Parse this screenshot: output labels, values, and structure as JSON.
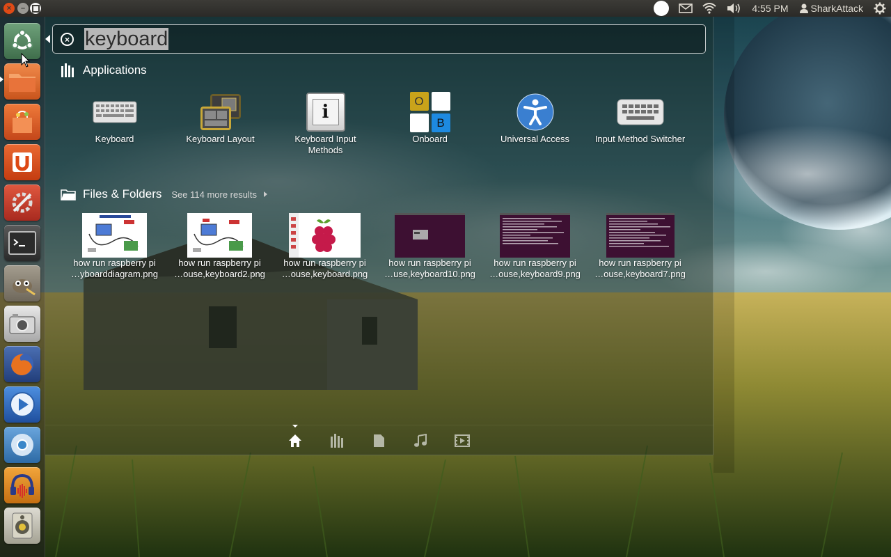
{
  "panel": {
    "clock": "4:55 PM",
    "user": "SharkAttack",
    "window_buttons": {
      "close": "×",
      "minimize": "–"
    },
    "indicators": [
      "notification-dot",
      "mail-icon",
      "wifi-icon",
      "volume-icon",
      "user-icon",
      "gear-icon"
    ]
  },
  "launcher": {
    "items": [
      {
        "name": "dash-home",
        "icon": "ubuntu-logo-icon",
        "color": "#5c8e6a"
      },
      {
        "name": "files",
        "icon": "folder-icon",
        "color": "#e0672a"
      },
      {
        "name": "software-center",
        "icon": "shopping-bag-icon",
        "color": "#d9572a"
      },
      {
        "name": "ubuntu-one",
        "icon": "ubuntu-one-icon",
        "color": "#dd4814"
      },
      {
        "name": "system-settings",
        "icon": "settings-wrench-icon",
        "color": "#c83a2e"
      },
      {
        "name": "terminal",
        "icon": "terminal-icon",
        "color": "#3a3a3a"
      },
      {
        "name": "gimp",
        "icon": "gimp-icon",
        "color": "#8a8376"
      },
      {
        "name": "screenshot",
        "icon": "camera-icon",
        "color": "#c9c9c9"
      },
      {
        "name": "firefox",
        "icon": "firefox-icon",
        "color": "#d96b1f"
      },
      {
        "name": "media-player",
        "icon": "play-icon",
        "color": "#2f6fc0"
      },
      {
        "name": "chromium",
        "icon": "chromium-icon",
        "color": "#3a87c9"
      },
      {
        "name": "audacity",
        "icon": "audacity-icon",
        "color": "#d98d1f"
      },
      {
        "name": "speaker",
        "icon": "speaker-icon",
        "color": "#b9b7ac"
      }
    ]
  },
  "dash": {
    "search": {
      "value": "keyboard",
      "clear_glyph": "×"
    },
    "applications": {
      "heading": "Applications",
      "items": [
        {
          "label": "Keyboard",
          "icon": "keyboard-icon"
        },
        {
          "label": "Keyboard Layout",
          "icon": "keyboard-layout-icon"
        },
        {
          "label_line1": "Keyboard Input",
          "label_line2": "Methods",
          "icon": "info-icon",
          "glyph": "i"
        },
        {
          "label": "Onboard",
          "icon": "onboard-icon",
          "glyph_o": "O",
          "glyph_b": "B"
        },
        {
          "label": "Universal Access",
          "icon": "accessibility-icon"
        },
        {
          "label": "Input Method Switcher",
          "icon": "keyboard-switcher-icon"
        }
      ]
    },
    "files": {
      "heading": "Files & Folders",
      "see_more": "See 114 more results",
      "items": [
        {
          "line1": "how  run raspberry pi",
          "line2": "…yboarddiagram.png",
          "thumb": "diagram"
        },
        {
          "line1": "how  run raspberry pi",
          "line2": "…ouse,keyboard2.png",
          "thumb": "diagram"
        },
        {
          "line1": "how  run raspberry pi",
          "line2": "…ouse,keyboard.png",
          "thumb": "raspberry"
        },
        {
          "line1": "how  run raspberry pi",
          "line2": "…use,keyboard10.png",
          "thumb": "desktop"
        },
        {
          "line1": "how  run raspberry pi",
          "line2": "…ouse,keyboard9.png",
          "thumb": "terminal"
        },
        {
          "line1": "how  run raspberry pi",
          "line2": "…ouse,keyboard7.png",
          "thumb": "terminal"
        }
      ]
    },
    "lenses": [
      {
        "name": "home",
        "icon": "home-icon",
        "active": true
      },
      {
        "name": "applications",
        "icon": "applications-icon",
        "active": false
      },
      {
        "name": "files",
        "icon": "file-icon",
        "active": false
      },
      {
        "name": "music",
        "icon": "music-icon",
        "active": false
      },
      {
        "name": "video",
        "icon": "video-icon",
        "active": false
      }
    ]
  }
}
